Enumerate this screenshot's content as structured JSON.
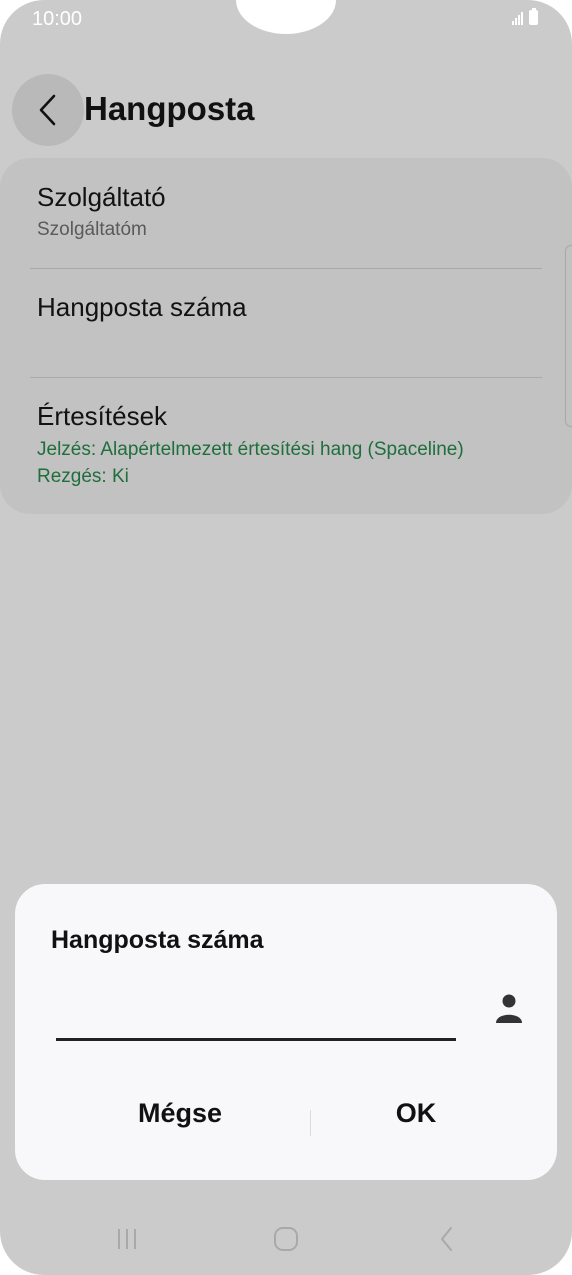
{
  "status_bar": {
    "time": "10:00",
    "icons": [
      "signal-icon",
      "battery-icon"
    ]
  },
  "header": {
    "title": "Hangposta",
    "back_icon": "chevron-left-icon"
  },
  "settings": {
    "provider": {
      "title": "Szolgáltató",
      "subtitle": "Szolgáltatóm"
    },
    "voicemail_number": {
      "title": "Hangposta száma"
    },
    "notifications": {
      "title": "Értesítések",
      "line1": "Jelzés: Alapértelmezett értesítési hang (Spaceline)",
      "line2": "Rezgés: Ki"
    }
  },
  "dialog": {
    "title": "Hangposta száma",
    "input_value": "",
    "contact_icon": "person-icon",
    "cancel_label": "Mégse",
    "ok_label": "OK"
  },
  "navigation": {
    "items": [
      "recents-icon",
      "home-icon",
      "back-icon"
    ]
  },
  "colors": {
    "accent_green": "#1f6e3d",
    "dim_background": "#cbcbcb",
    "dialog_background": "#f8f8fa"
  }
}
